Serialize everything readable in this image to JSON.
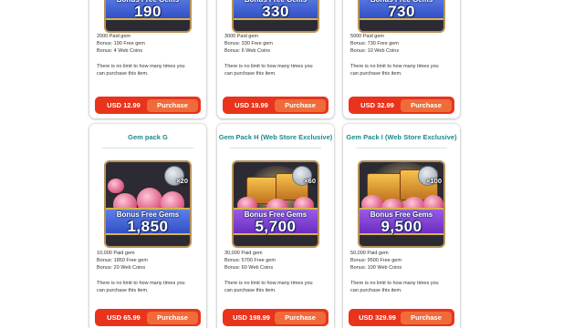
{
  "ribbon_label": "Bonus Free Gems",
  "purchase_label": "Purchase",
  "colors": {
    "title": "#1d8a8a",
    "buy_bar": "#e8341c",
    "purchase_button": "#f06b3a"
  },
  "top_row": [
    {
      "amount": "190",
      "paid": "2000 Paid gem",
      "bonus_gems": "Bonus: 190 Free gem",
      "bonus_coins": "Bonus: 4 Web Coins",
      "limit_line1": "There is no limit to how many times you",
      "limit_line2": "can purchase this item.",
      "price": "USD 12.99"
    },
    {
      "amount": "330",
      "paid": "3000 Paid gem",
      "bonus_gems": "Bonus: 330 Free gem",
      "bonus_coins": "Bonus: 6 Web Coins",
      "limit_line1": "There is no limit to how many times you",
      "limit_line2": "can purchase this item.",
      "price": "USD 19.99"
    },
    {
      "amount": "730",
      "paid": "5000 Paid gem",
      "bonus_gems": "Bonus: 730 Free gem",
      "bonus_coins": "Bonus: 10 Web Coins",
      "limit_line1": "There is no limit to how many times you",
      "limit_line2": "can purchase this item.",
      "price": "USD 32.99"
    }
  ],
  "bottom_row": [
    {
      "title": "Gem pack G",
      "badge_count": "×20",
      "amount": "1,850",
      "ribbon_color": "blue",
      "paid": "10,000 Paid gem",
      "bonus_gems": "Bonus: 1850 Free gem",
      "bonus_coins": "Bonus: 20 Web Coins",
      "limit_line1": "There is no limit to how many times you",
      "limit_line2": "can purchase this item.",
      "price": "USD 65.99"
    },
    {
      "title": "Gem Pack H (Web Store Exclusive)",
      "badge_count": "×60",
      "amount": "5,700",
      "ribbon_color": "purple",
      "paid": "30,000 Paid gem",
      "bonus_gems": "Bonus: 5700 Free gem",
      "bonus_coins": "Bonus: 60 Web Coins",
      "limit_line1": "There is no limit to how many times you",
      "limit_line2": "can purchase this item.",
      "price": "USD 198.99"
    },
    {
      "title": "Gem Pack I (Web Store Exclusive)",
      "badge_count": "×100",
      "amount": "9,500",
      "ribbon_color": "purple",
      "paid": "50,000 Paid gem",
      "bonus_gems": "Bonus: 9500 Free gem",
      "bonus_coins": "Bonus: 100 Web Coins",
      "limit_line1": "There is no limit to how many times you",
      "limit_line2": "can purchase this item.",
      "price": "USD 329.99"
    }
  ]
}
